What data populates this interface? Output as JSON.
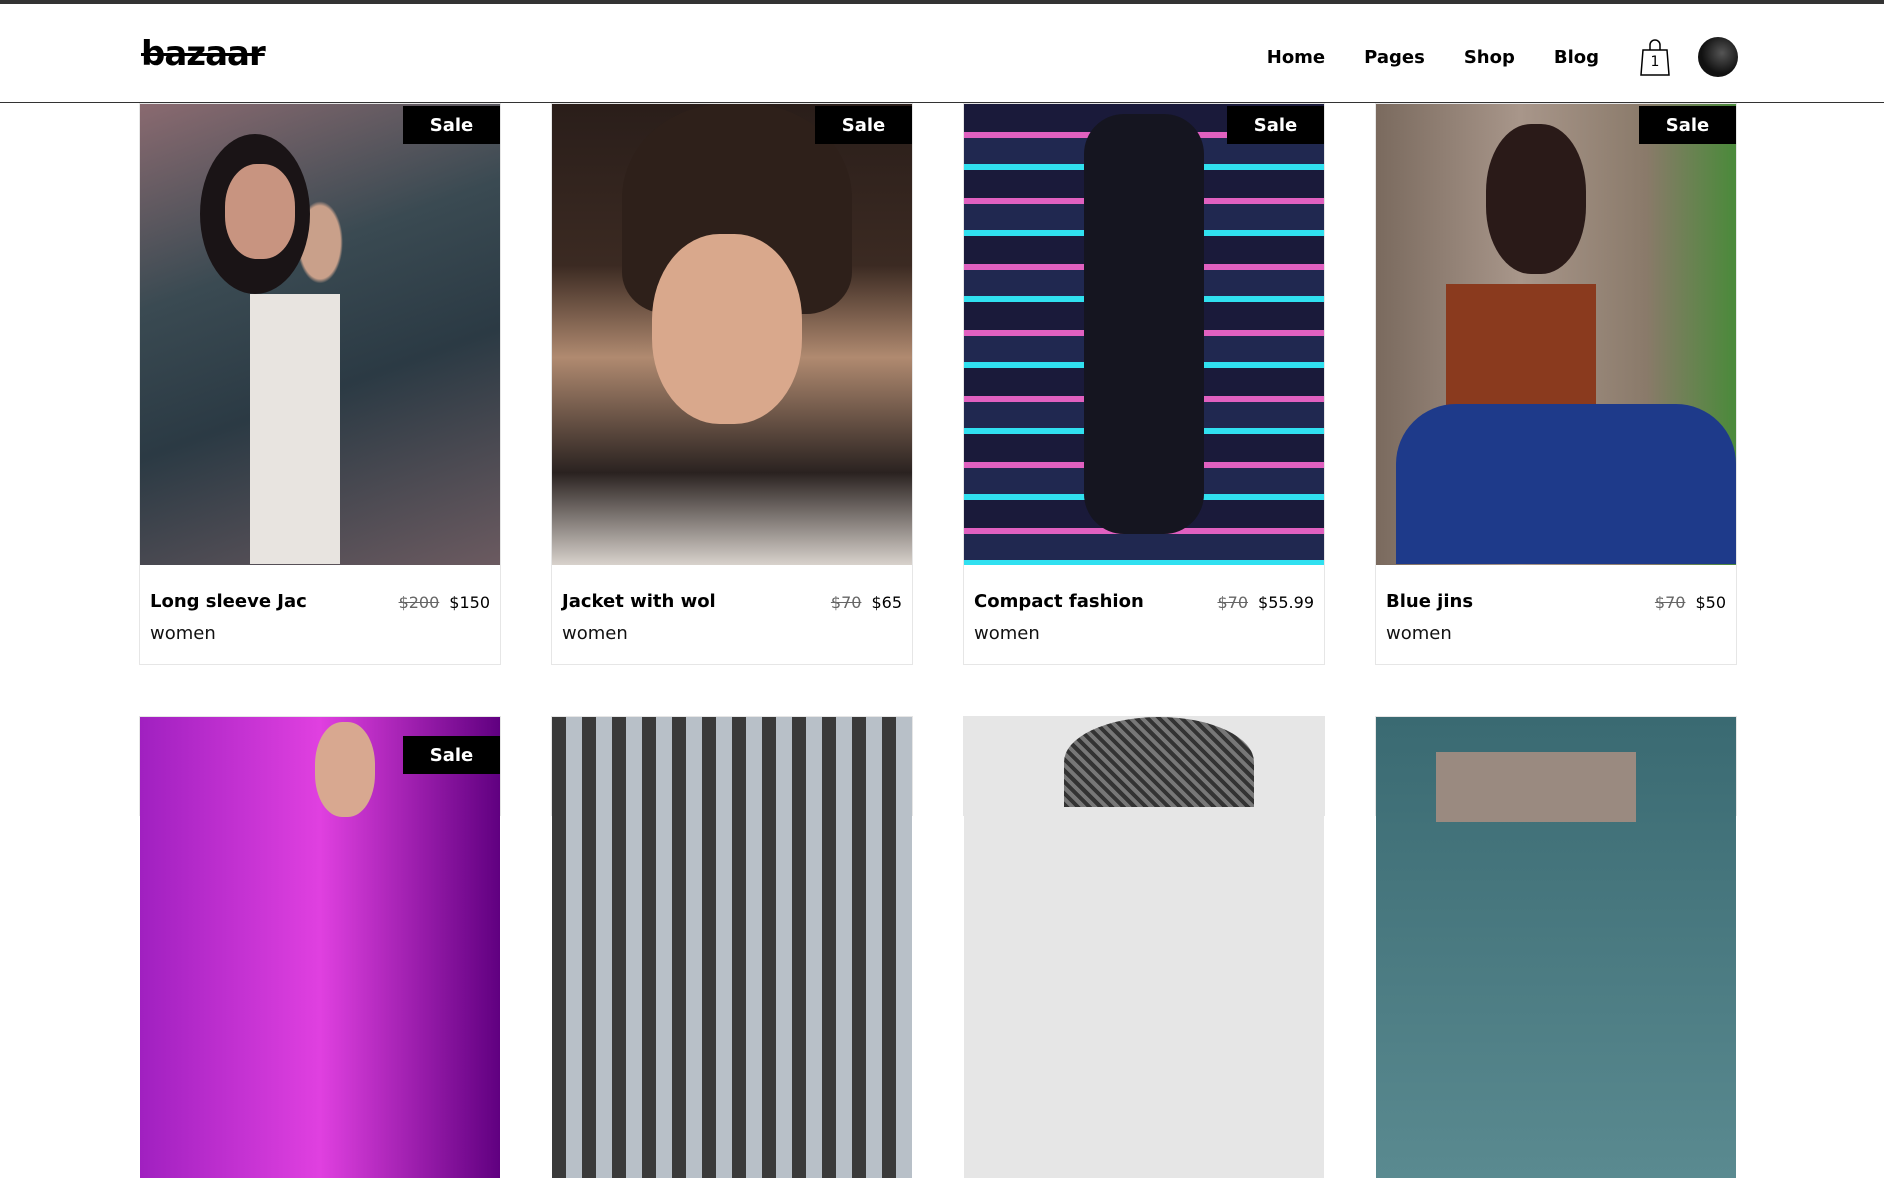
{
  "brand": "bazaar",
  "nav": [
    "Home",
    "Pages",
    "Shop",
    "Blog"
  ],
  "cart_count": "1",
  "products": [
    {
      "title": "Long sleeve Jac",
      "old": "$200",
      "price": "$150",
      "cat": "women",
      "badge": "Sale"
    },
    {
      "title": "Jacket with wol",
      "old": "$70",
      "price": "$65",
      "cat": "women",
      "badge": "Sale"
    },
    {
      "title": "Compact fashion",
      "old": "$70",
      "price": "$55.99",
      "cat": "women",
      "badge": "Sale"
    },
    {
      "title": "Blue jins",
      "old": "$70",
      "price": "$50",
      "cat": "women",
      "badge": "Sale"
    }
  ],
  "row2_badge": "Sale"
}
